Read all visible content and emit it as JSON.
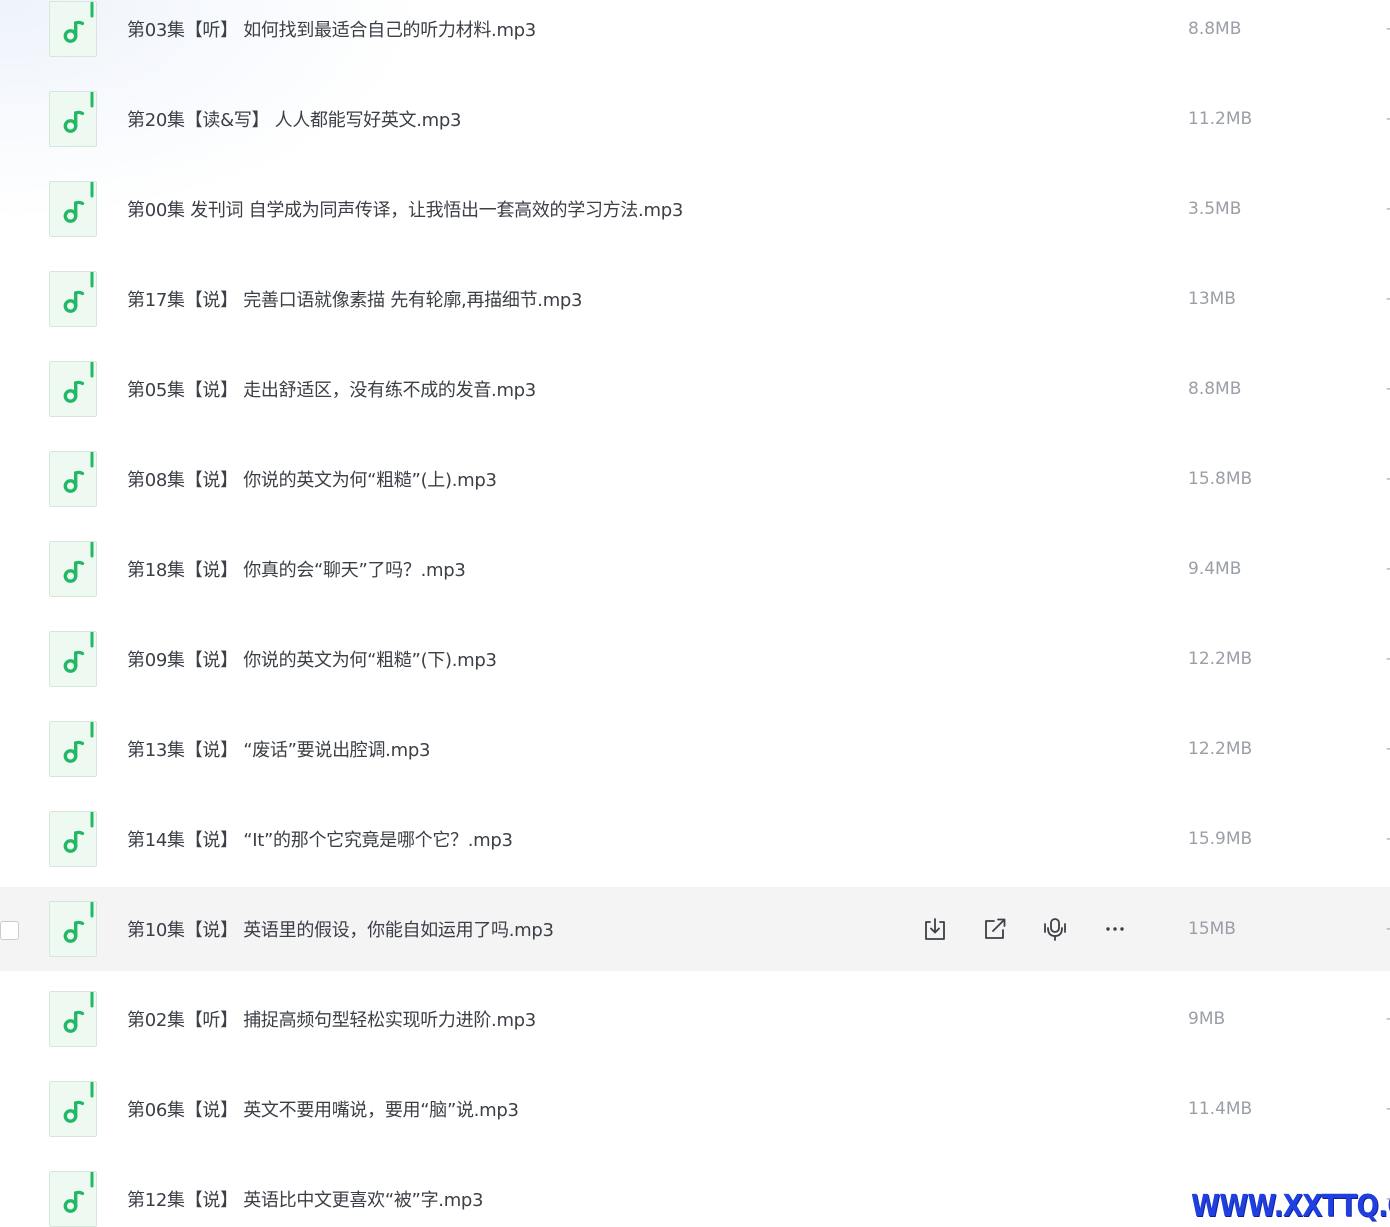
{
  "colors": {
    "accent_green": "#22b865",
    "thumb_bg": "#eef9f2",
    "hover_row_bg": "#f4f4f5",
    "filename_text": "#3b3f46",
    "size_text": "#9a9ea6",
    "watermark": "#1f3fe0"
  },
  "file_icon": "music-note-icon",
  "files": [
    {
      "name": "第03集【听】 如何找到最适合自己的听力材料.mp3",
      "size": "8.8MB"
    },
    {
      "name": "第20集【读&写】 人人都能写好英文.mp3",
      "size": "11.2MB"
    },
    {
      "name": "第00集 发刊词 自学成为同声传译，让我悟出一套高效的学习方法.mp3",
      "size": "3.5MB"
    },
    {
      "name": "第17集【说】 完善口语就像素描 先有轮廓,再描细节.mp3",
      "size": "13MB"
    },
    {
      "name": "第05集【说】 走出舒适区，没有练不成的发音.mp3",
      "size": "8.8MB"
    },
    {
      "name": "第08集【说】 你说的英文为何“粗糙”(上).mp3",
      "size": "15.8MB"
    },
    {
      "name": "第18集【说】 你真的会“聊天”了吗？.mp3",
      "size": "9.4MB"
    },
    {
      "name": "第09集【说】 你说的英文为何“粗糙”(下).mp3",
      "size": "12.2MB"
    },
    {
      "name": "第13集【说】 “废话”要说出腔调.mp3",
      "size": "12.2MB"
    },
    {
      "name": "第14集【说】 “It”的那个它究竟是哪个它？.mp3",
      "size": "15.9MB"
    },
    {
      "name": "第10集【说】 英语里的假设，你能自如运用了吗.mp3",
      "size": "15MB"
    },
    {
      "name": "第02集【听】 捕捉高频句型轻松实现听力进阶.mp3",
      "size": "9MB"
    },
    {
      "name": "第06集【说】 英文不要用嘴说，要用“脑”说.mp3",
      "size": "11.4MB"
    },
    {
      "name": "第12集【说】 英语比中文更喜欢“被”字.mp3",
      "size": ""
    }
  ],
  "hovered_row_index": 10,
  "hover_actions": [
    {
      "icon": "download-icon",
      "name": "download-button"
    },
    {
      "icon": "share-icon",
      "name": "share-button"
    },
    {
      "icon": "transcribe-audio-icon",
      "name": "transcribe-button"
    },
    {
      "icon": "more-icon",
      "name": "more-button"
    }
  ],
  "edge_mark": "-",
  "watermark_text": "WWW.XXTTQ.COM"
}
